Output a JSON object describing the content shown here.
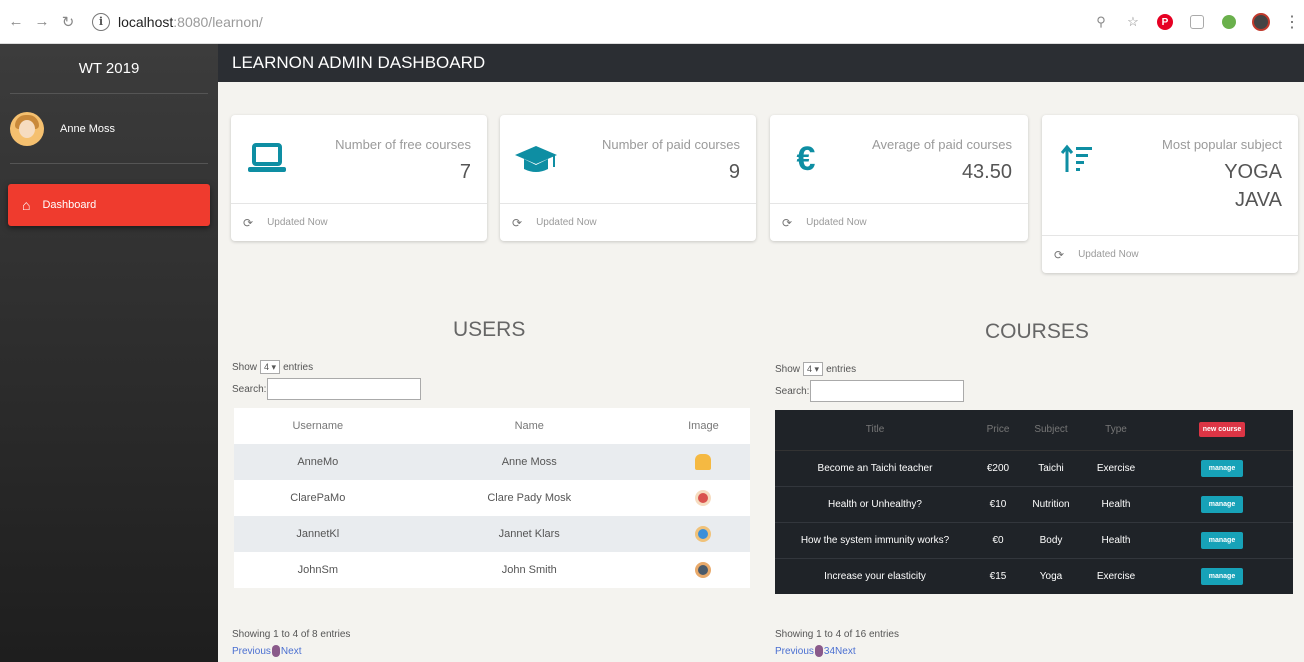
{
  "browser": {
    "host": "localhost",
    "path": ":8080/learnon/"
  },
  "sidebar": {
    "brand": "WT 2019",
    "user_name": "Anne Moss",
    "nav": [
      {
        "label": "Dashboard",
        "icon": "home-icon",
        "active": true
      }
    ]
  },
  "header": {
    "title": "LEARNON ADMIN DASHBOARD"
  },
  "stats": [
    {
      "label": "Number of free courses",
      "values": [
        "7"
      ],
      "icon": "laptop-icon",
      "footer": "Updated Now"
    },
    {
      "label": "Number of paid courses",
      "values": [
        "9"
      ],
      "icon": "graduation-cap-icon",
      "footer": "Updated Now"
    },
    {
      "label": "Average of paid courses",
      "values": [
        "43.50"
      ],
      "icon": "euro-icon",
      "footer": "Updated Now"
    },
    {
      "label": "Most popular subject",
      "values": [
        "YOGA",
        "JAVA"
      ],
      "icon": "sort-amount-icon",
      "footer": "Updated Now"
    }
  ],
  "users": {
    "title": "USERS",
    "show_label": "Show",
    "entries_value": "4",
    "entries_label": "entries",
    "search_label": "Search:",
    "columns": [
      "Username",
      "Name",
      "Image"
    ],
    "rows": [
      {
        "username": "AnneMo",
        "name": "Anne Moss",
        "avatar": "woman-blonde-avatar-icon",
        "avatar_color": "#f5b942"
      },
      {
        "username": "ClarePaMo",
        "name": "Clare Pady Mosk",
        "avatar": "woman-red-hair-avatar-icon",
        "avatar_color": "#d9534f"
      },
      {
        "username": "JannetKl",
        "name": "Jannet Klars",
        "avatar": "woman-blue-avatar-icon",
        "avatar_color": "#3b8fd9"
      },
      {
        "username": "JohnSm",
        "name": "John Smith",
        "avatar": "man-avatar-icon",
        "avatar_color": "#4a5a6a"
      }
    ],
    "info": "Showing 1 to 4 of 8 entries",
    "prev": "Previous",
    "next": "Next"
  },
  "courses": {
    "title": "COURSES",
    "show_label": "Show",
    "entries_value": "4",
    "entries_label": "entries",
    "search_label": "Search:",
    "columns": [
      "Title",
      "Price",
      "Subject",
      "Type"
    ],
    "new_button": "new course",
    "manage_label": "manage",
    "rows": [
      {
        "title": "Become an Taichi teacher",
        "price": "€200",
        "subject": "Taichi",
        "type": "Exercise"
      },
      {
        "title": "Health or Unhealthy?",
        "price": "€10",
        "subject": "Nutrition",
        "type": "Health"
      },
      {
        "title": "How the system immunity works?",
        "price": "€0",
        "subject": "Body",
        "type": "Health"
      },
      {
        "title": "Increase your elasticity",
        "price": "€15",
        "subject": "Yoga",
        "type": "Exercise"
      }
    ],
    "info": "Showing 1 to 4 of 16 entries",
    "prev": "Previous",
    "pages": "34",
    "next": "Next"
  },
  "colors": {
    "sidebar_active": "#ef3b2e",
    "icon_accent": "#0e8ea3",
    "topbar": "#2b2e33",
    "new_course_button": "#dc3545",
    "manage_button": "#17a2b8"
  }
}
